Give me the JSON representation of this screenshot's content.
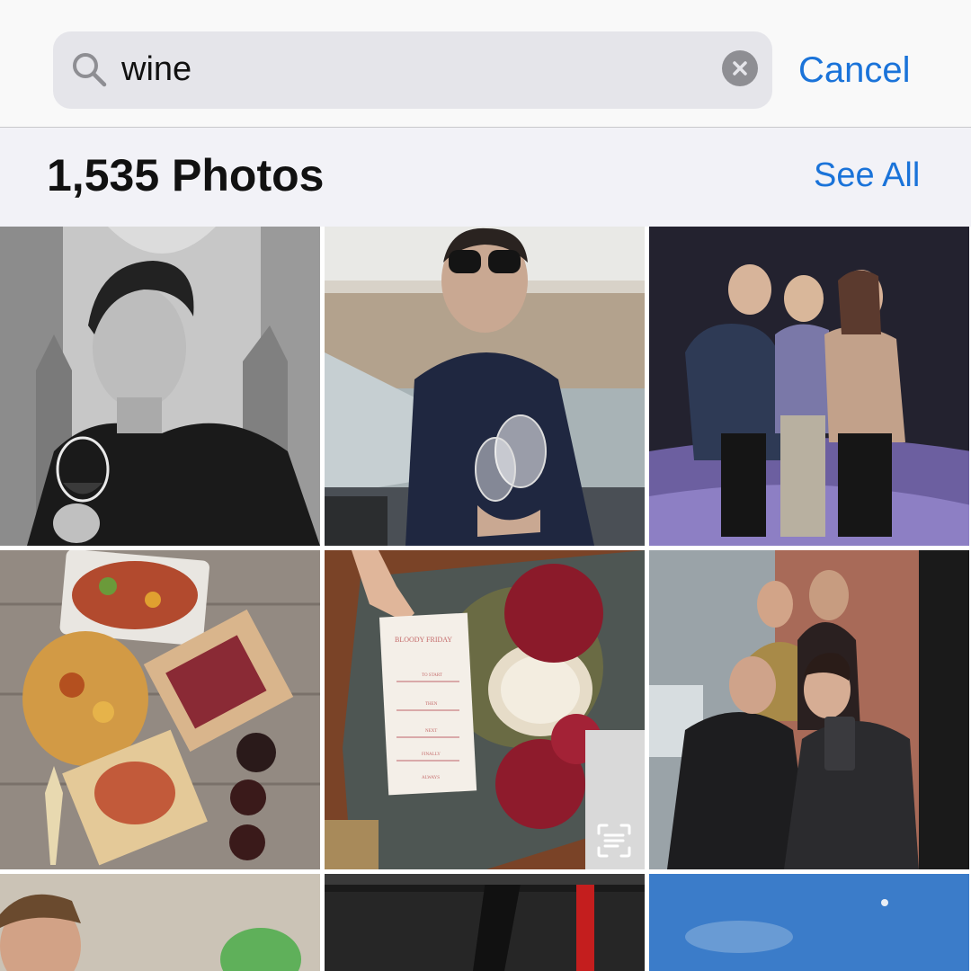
{
  "search": {
    "query": "wine",
    "clear_icon": "xmark-circle-icon",
    "search_icon": "magnifyingglass-icon",
    "cancel_label": "Cancel"
  },
  "section": {
    "title": "1,535 Photos",
    "see_all_label": "See All"
  },
  "photos": [
    {
      "description_icon": "photo-thumbnail"
    },
    {
      "description_icon": "photo-thumbnail"
    },
    {
      "description_icon": "photo-thumbnail"
    },
    {
      "description_icon": "photo-thumbnail"
    },
    {
      "description_icon": "photo-thumbnail"
    },
    {
      "description_icon": "photo-thumbnail"
    },
    {
      "description_icon": "photo-thumbnail"
    },
    {
      "description_icon": "photo-thumbnail"
    },
    {
      "description_icon": "photo-thumbnail"
    }
  ],
  "menu_card": {
    "heading": "BLOODY FRIDAY",
    "courses": [
      "TO START",
      "THEN",
      "NEXT",
      "FINALLY",
      "ALWAYS"
    ]
  },
  "colors": {
    "accent": "#1a73d9",
    "search_field": "#e5e5ea",
    "background": "#f2f2f7"
  }
}
